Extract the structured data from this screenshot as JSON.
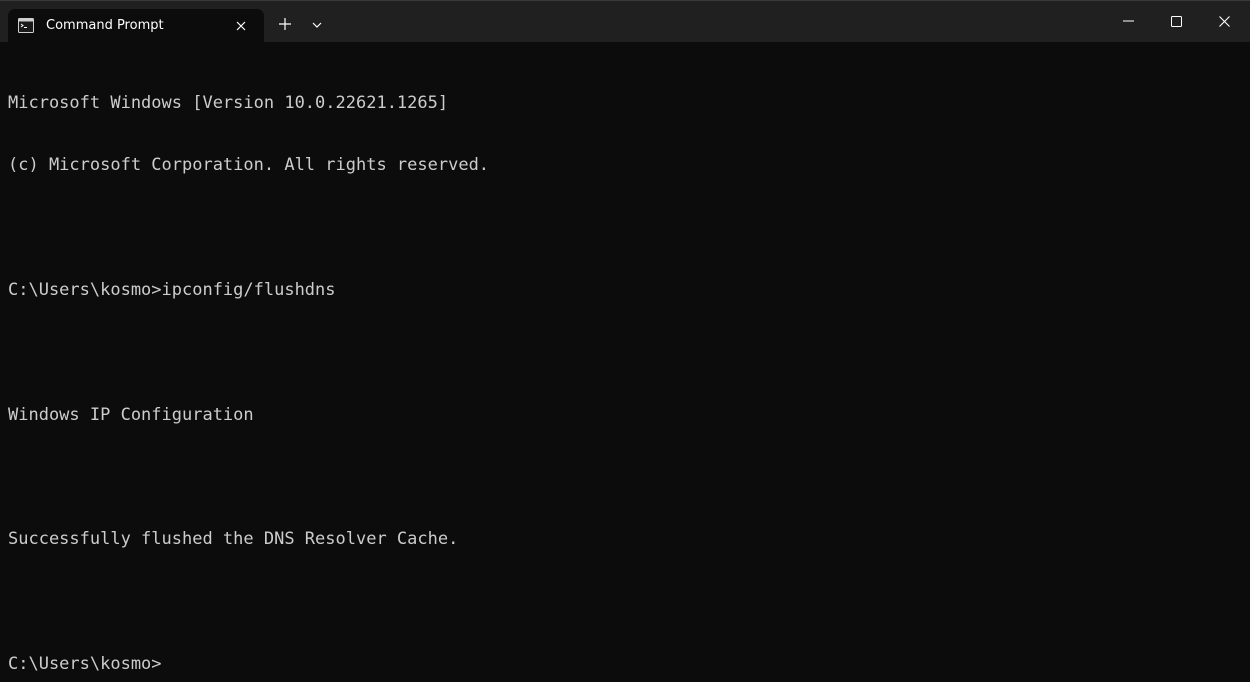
{
  "tab": {
    "title": "Command Prompt",
    "icon": "console-icon"
  },
  "titlebar": {
    "new_tab_icon": "plus-icon",
    "dropdown_icon": "chevron-down-icon",
    "minimize_icon": "minimize-icon",
    "maximize_icon": "maximize-icon",
    "close_icon": "close-icon"
  },
  "console": {
    "lines": [
      "Microsoft Windows [Version 10.0.22621.1265]",
      "(c) Microsoft Corporation. All rights reserved.",
      "",
      "C:\\Users\\kosmo>ipconfig/flushdns",
      "",
      "Windows IP Configuration",
      "",
      "Successfully flushed the DNS Resolver Cache.",
      "",
      "C:\\Users\\kosmo>"
    ]
  },
  "colors": {
    "background": "#0c0c0c",
    "titlebar": "#202020",
    "text": "#cccccc",
    "tab_text": "#ffffff"
  }
}
